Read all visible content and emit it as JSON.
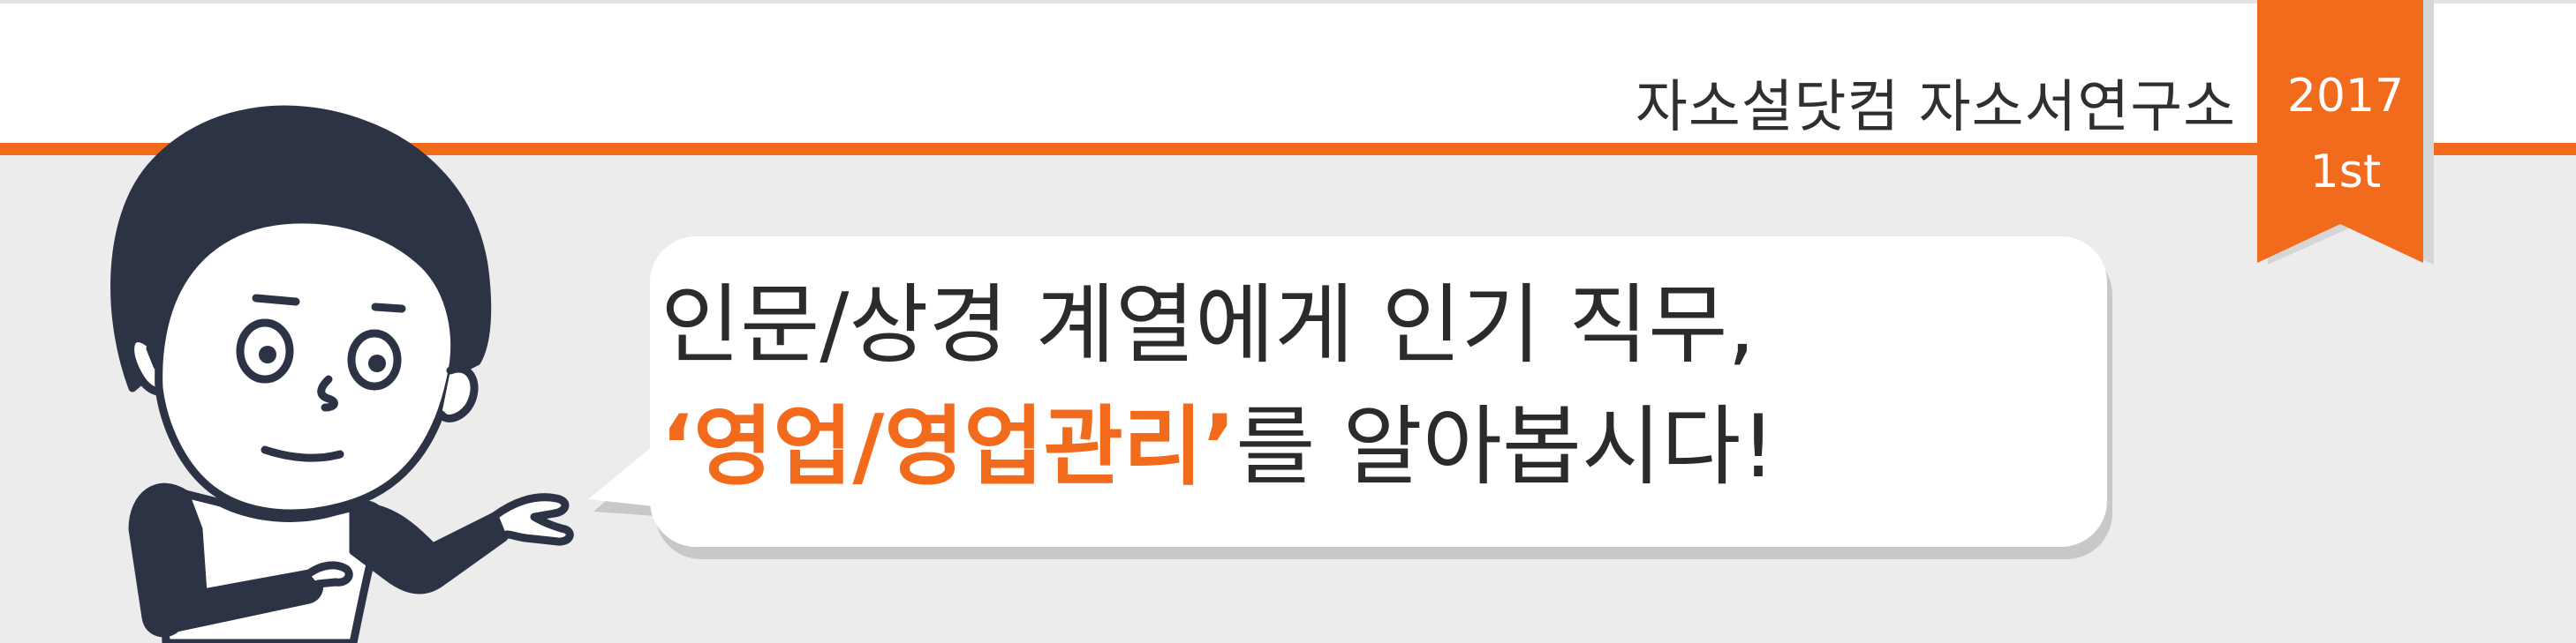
{
  "brand": {
    "name": "자소설닷컴 자소서연구소"
  },
  "ribbon": {
    "year": "2017",
    "edition": "1st"
  },
  "headline": {
    "line1": "인문/상경 계열에게 인기 직무,",
    "quote_open": "‘",
    "highlight": "영업/영업관리",
    "quote_close": "’",
    "line2_rest": "를 알아봅시다!"
  },
  "colors": {
    "accent": "#f26a1b",
    "ribbon": "#f26a1b",
    "outline": "#2b3344",
    "background": "#ececec"
  },
  "icons": {
    "character": "pointing-man-illustration",
    "speech_bubble": "speech-bubble"
  }
}
